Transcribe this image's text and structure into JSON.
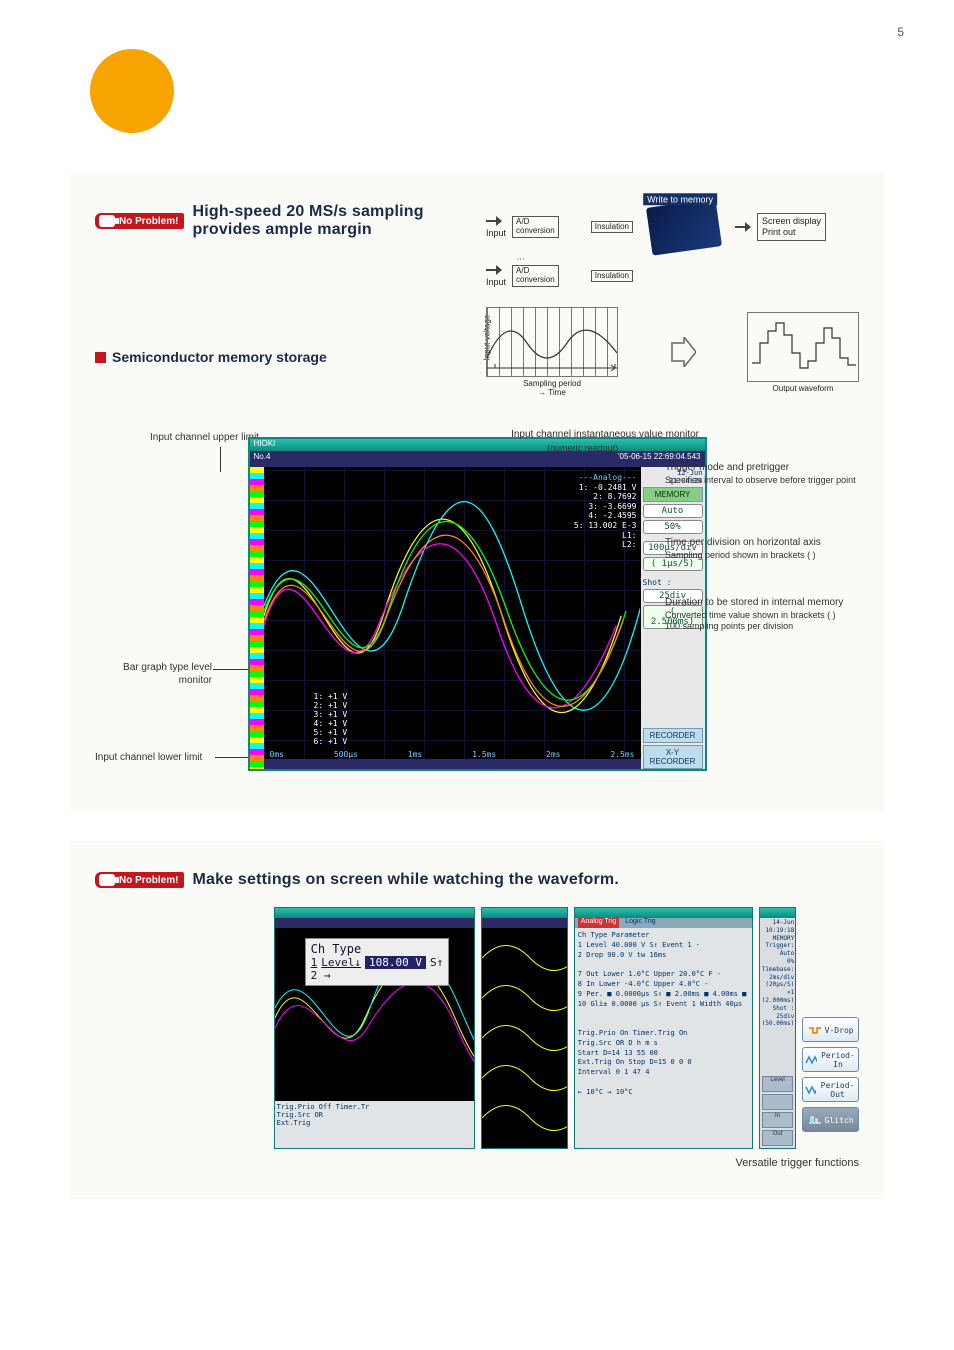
{
  "page_number": "5",
  "badge_label": "No Problem!",
  "section1": {
    "headline": "High-speed 20 MS/s sampling provides ample margin",
    "sub_heading": "Semiconductor memory storage",
    "diagram": {
      "input": "Input",
      "ad_conversion": "A/D\nconversion",
      "insulation": "Insulation",
      "write_memory": "Write to memory",
      "screen_display": "Screen display",
      "print_out": "Print out",
      "input_voltage": "Input voltage",
      "sampling_period": "Sampling period",
      "time": "Time",
      "output_waveform": "Output waveform"
    }
  },
  "screenshot": {
    "title_bar": "HIOKI",
    "header_left": "No.4",
    "header_right": "'05-06-15 22:69:04.543",
    "readout_title": "---Analog---",
    "readout_lines": [
      "1:  -0.2481 V",
      "2:   8.7692",
      "3:  -3.6699",
      "4:  -2.4595",
      "5:  13.002 E-3",
      "L1:",
      "L2:"
    ],
    "voltage_block": [
      "1:  +1 V",
      "2:  +1 V",
      "3:  +1 V",
      "4:  +1 V",
      "5:  +1 V",
      "6:  +1 V"
    ],
    "xaxis_ticks": [
      "0ms",
      "500µs",
      "1ms",
      "1.5ms",
      "2ms",
      "2.5ms"
    ],
    "side_tabs": [
      "MEMORY",
      "RECORDER",
      "X-Y RECORDER"
    ],
    "pills": {
      "trigger_mode": "Auto",
      "pretrigger": "50%",
      "time_div": "100µs/div",
      "sampling": "( 1µs/S)",
      "shot": "Shot   :",
      "shot_div": "25div",
      "shot_ms": "( 2.500ms)"
    },
    "mini_label": "(numeric readout)"
  },
  "annotations": {
    "upper_limit": "Input channel upper limit",
    "bar_graph": "Bar graph type level monitor",
    "lower_limit": "Input channel lower limit",
    "instant": "Input channel instantaneous value monitor",
    "trigger_title": "Trigger mode and pretrigger",
    "trigger_desc": "Specifies interval to observe before trigger point",
    "time_div_title": "Time per division on horizontal axis",
    "time_div_desc": "Sampling period shown in brackets (   )",
    "duration_title": "Duration to be stored in internal memory",
    "duration_desc1": "Converted time value shown in brackets (   )",
    "duration_desc2": "100 sampling points per division"
  },
  "section2": {
    "headline": "Make settings on screen while watching the waveform.",
    "chtype": {
      "line1": "Ch Type",
      "line2_a": "1",
      "line2_b": "Level↓",
      "line2_c": "108.00 V",
      "line2_d": "S↑",
      "line3": "2  →"
    },
    "caption": "Versatile trigger functions",
    "buttons": [
      "V-Drop",
      "Period-In",
      "Period-Out",
      "Glitch"
    ]
  }
}
